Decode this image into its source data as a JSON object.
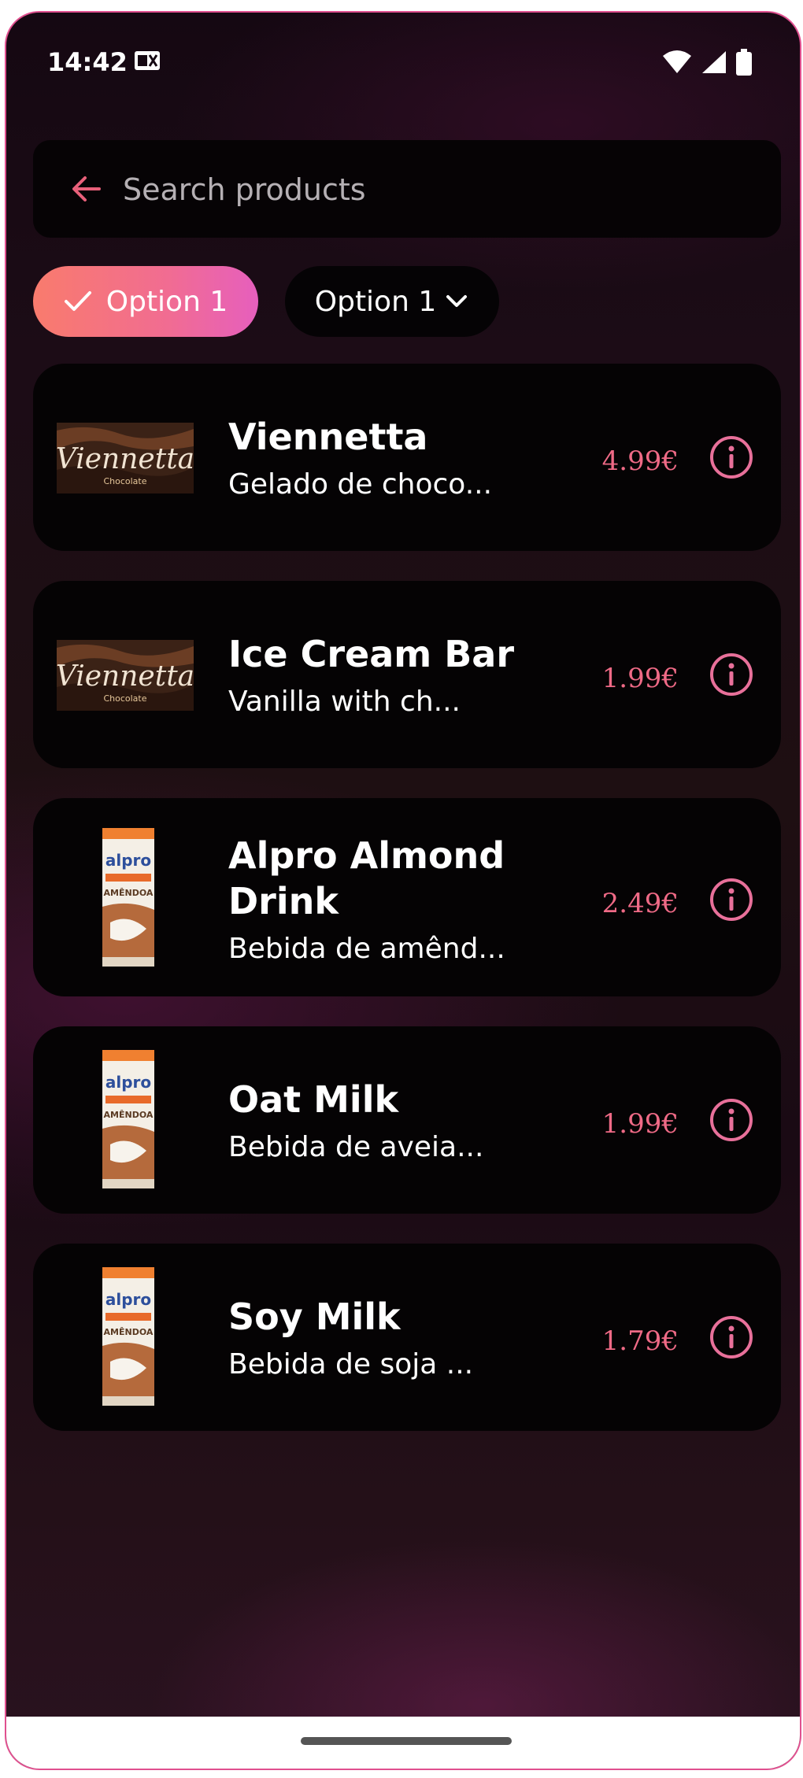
{
  "status_bar": {
    "time": "14:42"
  },
  "search": {
    "placeholder": "Search products"
  },
  "filters": {
    "selected_chip": "Option 1",
    "dropdown_chip": "Option 1"
  },
  "products": [
    {
      "name": "Viennetta",
      "description": "Gelado de choco...",
      "price": "4.99€",
      "image": "viennetta"
    },
    {
      "name": "Ice Cream Bar",
      "description": "Vanilla with ch...",
      "price": "1.99€",
      "image": "viennetta"
    },
    {
      "name": "Alpro Almond Drink",
      "description": "Bebida de amênd...",
      "price": "2.49€",
      "image": "alpro"
    },
    {
      "name": "Oat Milk",
      "description": "Bebida de aveia...",
      "price": "1.99€",
      "image": "alpro"
    },
    {
      "name": "Soy Milk",
      "description": "Bebida de soja ...",
      "price": "1.79€",
      "image": "alpro"
    }
  ],
  "colors": {
    "accent": "#ef6a86",
    "chip_gradient_start": "#f97b6d",
    "chip_gradient_end": "#e65fbd",
    "card_background": "#050304"
  },
  "icons": {
    "back": "arrow-left-icon",
    "check": "check-icon",
    "dropdown": "chevron-down-icon",
    "info": "info-icon"
  }
}
